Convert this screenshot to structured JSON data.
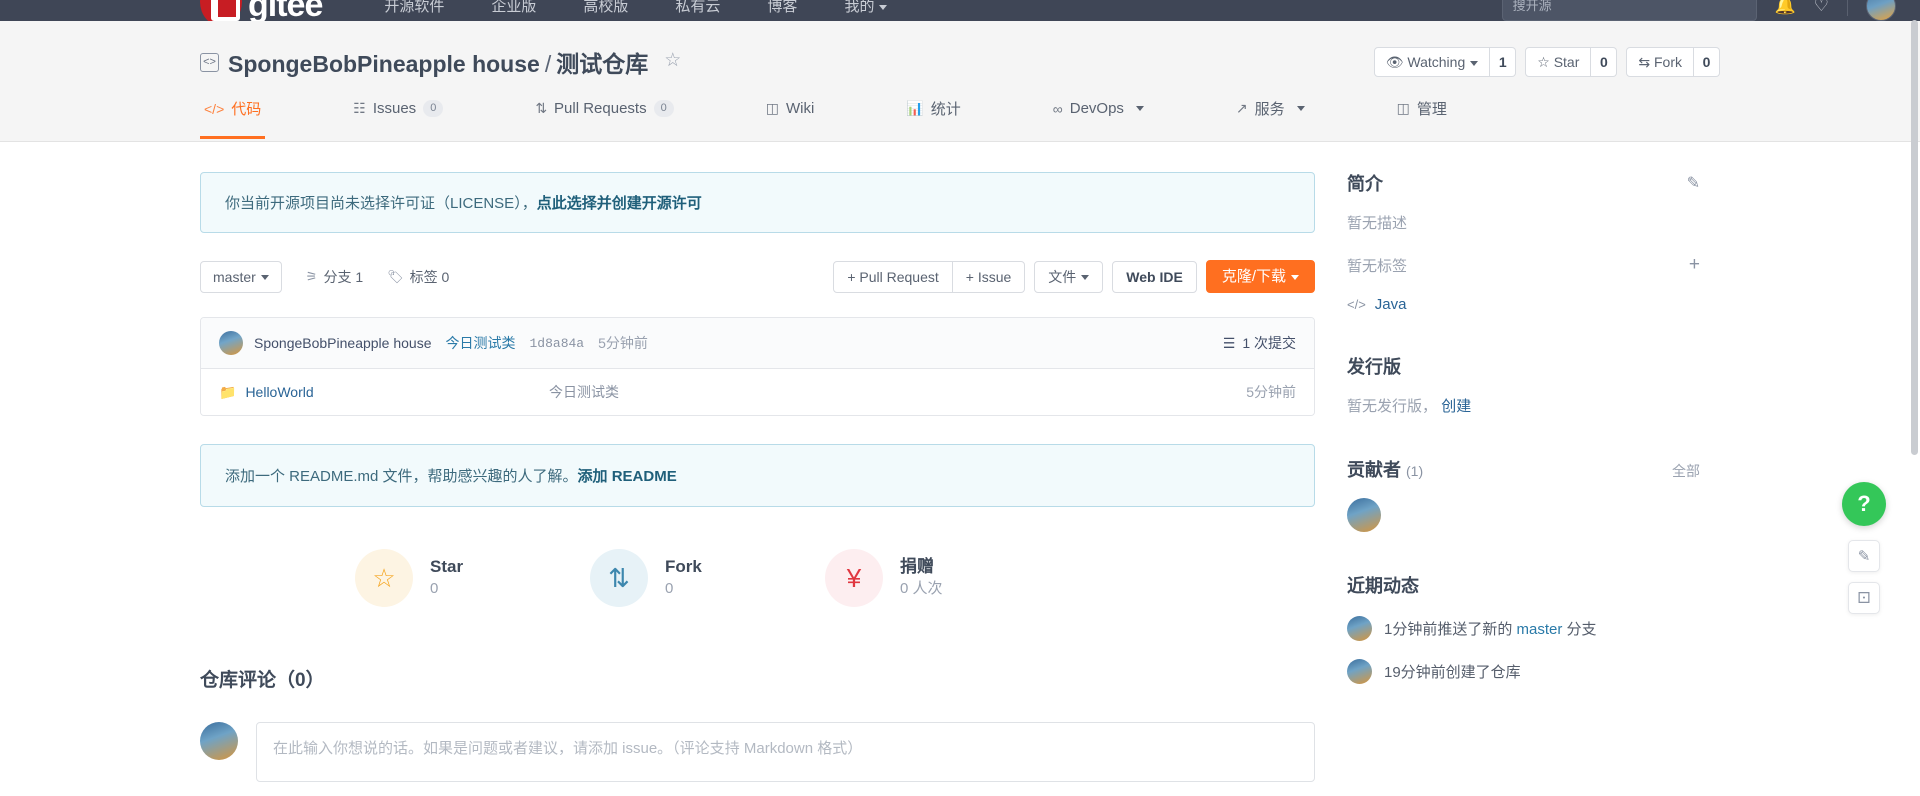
{
  "topnav": {
    "logo_text": "gitee",
    "items": [
      {
        "label": "开源软件"
      },
      {
        "label": "企业版"
      },
      {
        "label": "高校版"
      },
      {
        "label": "私有云"
      },
      {
        "label": "博客"
      },
      {
        "label": "我的"
      }
    ],
    "search_placeholder": "搜开源",
    "bell_icon": "bell-icon",
    "heart_icon": "heart-icon",
    "avatar": "user-avatar"
  },
  "repo": {
    "owner": "SpongeBobPineapple house",
    "separator": "/",
    "name": "测试仓库",
    "repo_icon": "code-brackets-icon",
    "badge_icon": "award-badge-icon",
    "watch": {
      "label": "Watching",
      "count": "1",
      "icon": "eye-icon"
    },
    "star": {
      "label": "Star",
      "count": "0",
      "icon": "star-icon"
    },
    "fork": {
      "label": "Fork",
      "count": "0",
      "icon": "fork-icon"
    }
  },
  "tabs": [
    {
      "label": "代码",
      "icon": "code-icon",
      "badge": "",
      "active": true
    },
    {
      "label": "Issues",
      "icon": "issue-list-icon",
      "badge": "0",
      "active": false
    },
    {
      "label": "Pull Requests",
      "icon": "pull-request-icon",
      "badge": "0",
      "active": false
    },
    {
      "label": "Wiki",
      "icon": "book-icon",
      "badge": "",
      "active": false
    },
    {
      "label": "统计",
      "icon": "chart-bar-icon",
      "badge": "",
      "active": false
    },
    {
      "label": "DevOps",
      "icon": "infinity-icon",
      "badge": "",
      "active": false,
      "dropdown": true
    },
    {
      "label": "服务",
      "icon": "activity-icon",
      "badge": "",
      "active": false,
      "dropdown": true
    },
    {
      "label": "管理",
      "icon": "settings-panel-icon",
      "badge": "",
      "active": false
    }
  ],
  "license_banner": {
    "text": "你当前开源项目尚未选择许可证（LICENSE），",
    "link": "点此选择并创建开源许可"
  },
  "toolbar": {
    "branch": "master",
    "branches_label": "分支 1",
    "branches_icon": "branch-icon",
    "tags_label": "标签 0",
    "tags_icon": "tag-icon",
    "pull_request_label": "+ Pull Request",
    "issue_label": "+ Issue",
    "files_label": "文件",
    "web_ide_label": "Web IDE",
    "clone_label": "克隆/下载"
  },
  "commit": {
    "author": "SpongeBobPineapple house",
    "message": "今日测试类",
    "sha": "1d8a84a",
    "time": "5分钟前",
    "count_label": "1 次提交",
    "count_icon": "commit-list-icon",
    "avatar": "author-avatar"
  },
  "files": [
    {
      "name": "HelloWorld",
      "icon": "folder-icon",
      "message": "今日测试类",
      "time": "5分钟前"
    }
  ],
  "readme_banner": {
    "text": "添加一个 README.md 文件，帮助感兴趣的人了解。",
    "link": "添加 README"
  },
  "stats": [
    {
      "label": "Star",
      "value": "0",
      "icon": "star-icon",
      "color": "#f5a623",
      "bg": "#fdf4e3"
    },
    {
      "label": "Fork",
      "value": "0",
      "icon": "fork-icon",
      "color": "#3d87ae",
      "bg": "#e7f2f7"
    },
    {
      "label": "捐赠",
      "value": "0 人次",
      "icon": "donate-hand-icon",
      "color": "#e0363f",
      "bg": "#fdeef0"
    }
  ],
  "comments": {
    "title": "仓库评论（0）",
    "placeholder": "在此输入你想说的话。如果是问题或者建议，请添加 issue。（评论支持 Markdown 格式）",
    "avatar": "current-user-avatar"
  },
  "sidebar": {
    "intro": {
      "title": "简介",
      "edit_icon": "edit-pencil-icon",
      "description": "暂无描述",
      "tags": "暂无标签",
      "add_tag_icon": "plus-icon",
      "language": "Java",
      "language_icon": "code-icon"
    },
    "releases": {
      "title": "发行版",
      "empty": "暂无发行版，",
      "create_link": "创建"
    },
    "contributors": {
      "title": "贡献者",
      "count": "(1)",
      "all_label": "全部",
      "avatars": [
        "contributor-avatar-1"
      ]
    },
    "activity": {
      "title": "近期动态",
      "items": [
        {
          "prefix": "1分钟前推送了新的 ",
          "highlight": "master",
          "suffix": " 分支",
          "avatar": "activity-avatar"
        },
        {
          "prefix": "19分钟前创建了仓库",
          "highlight": "",
          "suffix": "",
          "avatar": "activity-avatar"
        }
      ]
    }
  },
  "floating": {
    "help_label": "?",
    "edit_icon": "compose-icon",
    "feedback_icon": "chat-bubble-icon"
  }
}
